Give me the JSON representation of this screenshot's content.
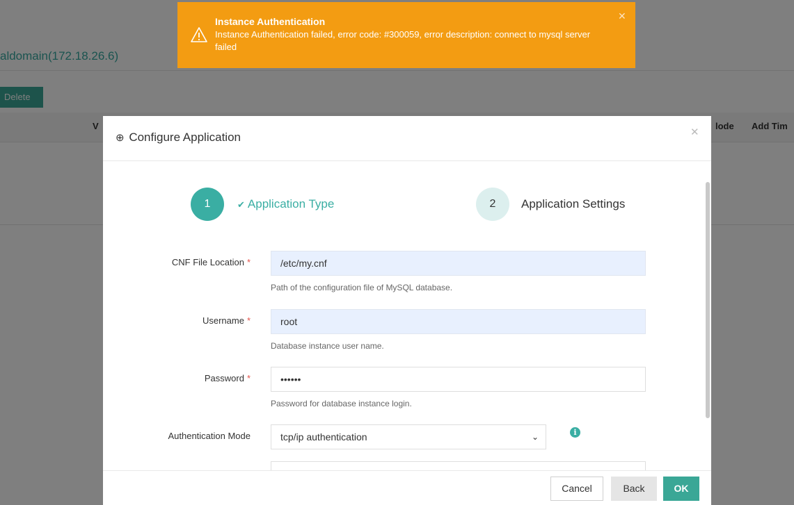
{
  "background": {
    "title": "aldomain(172.18.26.6)",
    "delete_label": "Delete",
    "columns": {
      "col_v": "V",
      "col_mode": "lode",
      "col_add_time": "Add Tim"
    }
  },
  "toast": {
    "title": "Instance Authentication",
    "message": "Instance Authentication failed, error code: #300059, error description: connect to mysql server failed",
    "color": "#f39c12"
  },
  "modal": {
    "title": "Configure Application",
    "steps": [
      {
        "number": "1",
        "label": "Application Type"
      },
      {
        "number": "2",
        "label": "Application Settings"
      }
    ],
    "fields": {
      "cnf": {
        "label": "CNF File Location",
        "value": "/etc/my.cnf",
        "hint": "Path of the configuration file of MySQL database."
      },
      "username": {
        "label": "Username",
        "value": "root",
        "hint": "Database instance user name."
      },
      "password": {
        "label": "Password",
        "value": "••••••",
        "hint": "Password for database instance login."
      },
      "auth_mode": {
        "label": "Authentication Mode",
        "value": "tcp/ip authentication"
      }
    },
    "required_mark": "*",
    "buttons": {
      "cancel": "Cancel",
      "back": "Back",
      "ok": "OK"
    }
  },
  "colors": {
    "accent": "#3aaea3",
    "button_green": "#3aa796",
    "warning": "#f39c12"
  }
}
